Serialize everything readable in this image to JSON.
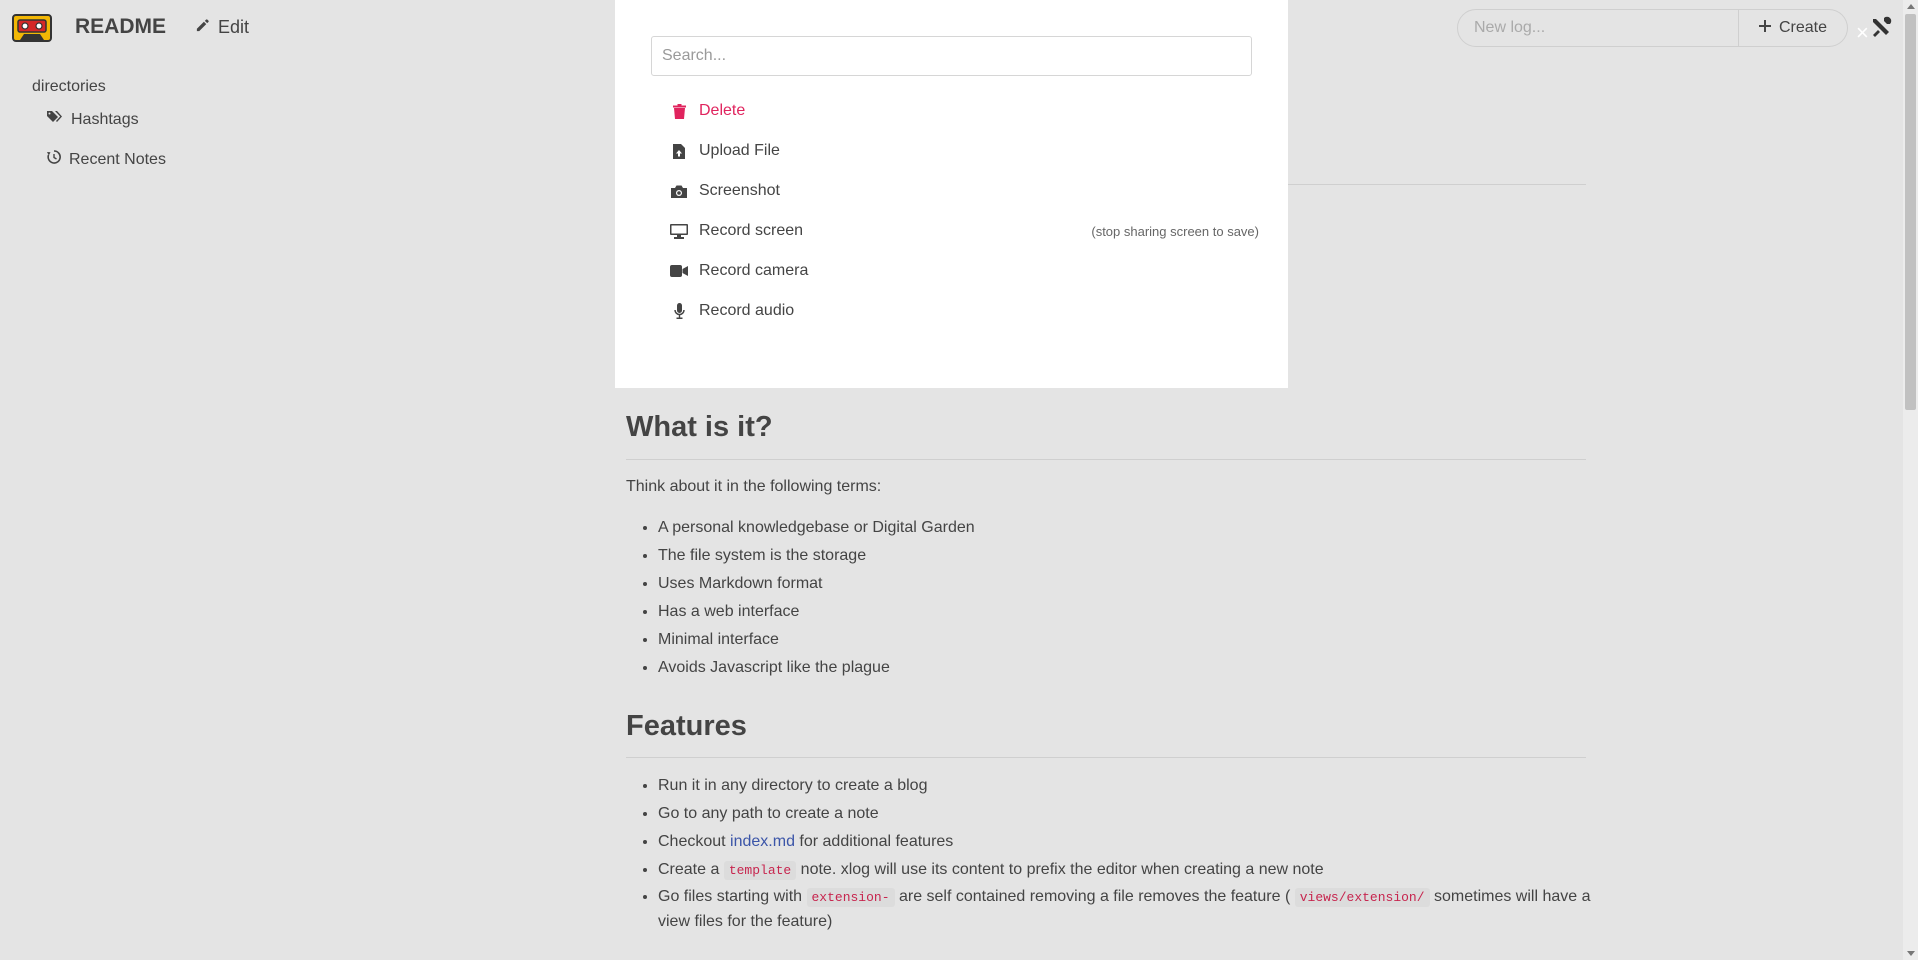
{
  "navbar": {
    "brand": "README",
    "edit_label": "Edit",
    "new_log_placeholder": "New log...",
    "create_label": "Create",
    "close_label": "×"
  },
  "sidebar": {
    "title": "directories",
    "items": [
      {
        "label": "Hashtags",
        "icon": "tags-icon"
      },
      {
        "label": "Recent Notes",
        "icon": "history-icon"
      }
    ]
  },
  "modal": {
    "search_placeholder": "Search...",
    "commands": [
      {
        "label": "Delete",
        "icon": "trash-icon",
        "hint": ""
      },
      {
        "label": "Upload File",
        "icon": "file-upload-icon",
        "hint": ""
      },
      {
        "label": "Screenshot",
        "icon": "camera-icon",
        "hint": ""
      },
      {
        "label": "Record screen",
        "icon": "desktop-icon",
        "hint": "(stop sharing screen to save)"
      },
      {
        "label": "Record camera",
        "icon": "video-icon",
        "hint": ""
      },
      {
        "label": "Record audio",
        "icon": "microphone-icon",
        "hint": ""
      }
    ]
  },
  "content": {
    "section1": {
      "heading": "What is it?",
      "intro": "Think about it in the following terms:",
      "items": [
        "A personal knowledgebase or Digital Garden",
        "The file system is the storage",
        "Uses Markdown format",
        "Has a web interface",
        "Minimal interface",
        "Avoids Javascript like the plague"
      ]
    },
    "section2": {
      "heading": "Features",
      "items": {
        "run": "Run it in any directory to create a blog",
        "goto": "Go to any path to create a note",
        "checkout_pre": "Checkout ",
        "checkout_link": "index.md",
        "checkout_post": " for additional features",
        "create_pre": "Create a ",
        "create_code": "template",
        "create_post": " note. xlog will use its content to prefix the editor when creating a new note",
        "go_pre": "Go files starting with ",
        "go_code1": "extension-",
        "go_mid": " are self contained removing a file removes the feature ( ",
        "go_code2": "views/extension/",
        "go_post": " sometimes will have a view files for the feature)"
      }
    }
  },
  "colors": {
    "background": "#e4e4e4",
    "danger": "#e0245e",
    "link": "#3b55a8"
  }
}
